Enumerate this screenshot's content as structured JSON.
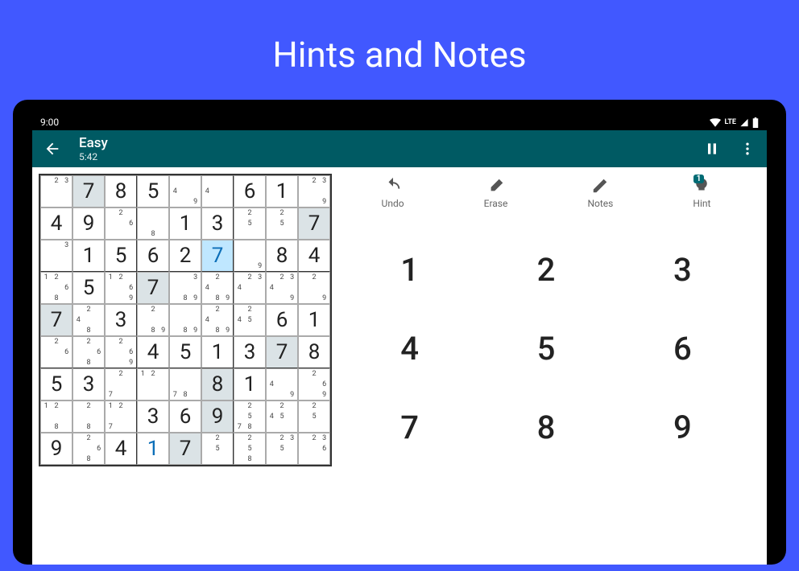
{
  "promo_title": "Hints and Notes",
  "status": {
    "time": "9:00",
    "lte": "LTE"
  },
  "appbar": {
    "title": "Easy",
    "timer": "5:42"
  },
  "actions": {
    "undo": "Undo",
    "erase": "Erase",
    "notes": "Notes",
    "hint": "Hint",
    "hint_badge": "1"
  },
  "numpad": [
    "1",
    "2",
    "3",
    "4",
    "5",
    "6",
    "7",
    "8",
    "9"
  ],
  "board": [
    [
      {
        "n": [
          null,
          "2",
          "3",
          null,
          null,
          null,
          null,
          null,
          null
        ]
      },
      {
        "v": "7",
        "f": 1
      },
      {
        "v": "8"
      },
      {
        "v": "5"
      },
      {
        "n": [
          null,
          null,
          null,
          "4",
          null,
          null,
          null,
          null,
          "9"
        ]
      },
      {
        "n": [
          null,
          null,
          null,
          "4",
          null,
          null,
          null,
          null,
          null
        ]
      },
      {
        "v": "6"
      },
      {
        "v": "1"
      },
      {
        "n": [
          null,
          "2",
          "3",
          null,
          null,
          null,
          null,
          null,
          "9"
        ]
      }
    ],
    [
      {
        "v": "4"
      },
      {
        "v": "9"
      },
      {
        "n": [
          null,
          "2",
          null,
          null,
          null,
          "6",
          null,
          null,
          null
        ]
      },
      {
        "n": [
          null,
          null,
          null,
          null,
          null,
          null,
          null,
          "8",
          null
        ]
      },
      {
        "v": "1"
      },
      {
        "v": "3"
      },
      {
        "n": [
          null,
          "2",
          null,
          null,
          "5",
          null,
          null,
          null,
          null
        ]
      },
      {
        "n": [
          null,
          "2",
          null,
          null,
          "5",
          null,
          null,
          null,
          null
        ]
      },
      {
        "v": "7",
        "f": 1
      }
    ],
    [
      {
        "n": [
          null,
          null,
          "3",
          null,
          null,
          null,
          null,
          null,
          null
        ]
      },
      {
        "v": "1"
      },
      {
        "v": "5"
      },
      {
        "v": "6"
      },
      {
        "v": "2"
      },
      {
        "v": "7",
        "u": 1,
        "hi": 1
      },
      {
        "n": [
          null,
          null,
          null,
          null,
          null,
          null,
          null,
          null,
          "9"
        ]
      },
      {
        "v": "8"
      },
      {
        "v": "4"
      }
    ],
    [
      {
        "n": [
          "1",
          "2",
          null,
          null,
          null,
          "6",
          null,
          "8",
          null
        ]
      },
      {
        "v": "5"
      },
      {
        "n": [
          "1",
          "2",
          null,
          null,
          null,
          "6",
          null,
          null,
          "9"
        ]
      },
      {
        "v": "7",
        "f": 1
      },
      {
        "n": [
          null,
          null,
          "3",
          null,
          null,
          null,
          null,
          "8",
          "9"
        ]
      },
      {
        "n": [
          null,
          "2",
          null,
          "4",
          null,
          null,
          null,
          "8",
          "9"
        ]
      },
      {
        "n": [
          null,
          "2",
          "3",
          "4",
          null,
          null,
          null,
          null,
          null
        ]
      },
      {
        "n": [
          null,
          "2",
          "3",
          "4",
          null,
          null,
          null,
          null,
          "9"
        ]
      },
      {
        "n": [
          null,
          "2",
          null,
          null,
          null,
          null,
          null,
          null,
          "9"
        ]
      }
    ],
    [
      {
        "v": "7",
        "f": 1
      },
      {
        "n": [
          null,
          "2",
          null,
          "4",
          null,
          null,
          null,
          "8",
          null
        ]
      },
      {
        "v": "3"
      },
      {
        "n": [
          null,
          "2",
          null,
          null,
          null,
          null,
          null,
          "8",
          "9"
        ]
      },
      {
        "n": [
          null,
          null,
          null,
          null,
          null,
          null,
          null,
          "8",
          "9"
        ]
      },
      {
        "n": [
          null,
          "2",
          null,
          "4",
          null,
          null,
          null,
          "8",
          "9"
        ]
      },
      {
        "n": [
          null,
          "2",
          null,
          "4",
          "5",
          null,
          null,
          null,
          null
        ]
      },
      {
        "v": "6"
      },
      {
        "v": "1"
      }
    ],
    [
      {
        "n": [
          null,
          "2",
          null,
          null,
          null,
          "6",
          null,
          null,
          null
        ]
      },
      {
        "n": [
          null,
          "2",
          null,
          null,
          null,
          "6",
          null,
          "8",
          null
        ]
      },
      {
        "n": [
          null,
          "2",
          null,
          null,
          null,
          "6",
          null,
          null,
          "9"
        ]
      },
      {
        "v": "4"
      },
      {
        "v": "5"
      },
      {
        "v": "1"
      },
      {
        "v": "3"
      },
      {
        "v": "7",
        "f": 1
      },
      {
        "v": "8"
      }
    ],
    [
      {
        "v": "5"
      },
      {
        "v": "3"
      },
      {
        "n": [
          null,
          "2",
          null,
          null,
          null,
          null,
          "7",
          null,
          null
        ]
      },
      {
        "n": [
          "1",
          "2",
          null,
          null,
          null,
          null,
          null,
          null,
          null
        ]
      },
      {
        "n": [
          null,
          null,
          null,
          null,
          null,
          null,
          "7",
          "8",
          null
        ]
      },
      {
        "v": "8",
        "f": 1
      },
      {
        "v": "1"
      },
      {
        "n": [
          null,
          null,
          null,
          "4",
          null,
          null,
          null,
          null,
          "9"
        ]
      },
      {
        "n": [
          null,
          "2",
          null,
          null,
          null,
          "6",
          null,
          null,
          "9"
        ]
      }
    ],
    [
      {
        "n": [
          "1",
          "2",
          null,
          null,
          null,
          null,
          null,
          "8",
          null
        ]
      },
      {
        "n": [
          null,
          "2",
          null,
          null,
          null,
          null,
          null,
          "8",
          null
        ]
      },
      {
        "n": [
          "1",
          "2",
          null,
          null,
          null,
          null,
          "7",
          null,
          null
        ]
      },
      {
        "v": "3"
      },
      {
        "v": "6"
      },
      {
        "v": "9",
        "f": 1
      },
      {
        "n": [
          null,
          "2",
          null,
          null,
          "5",
          null,
          "7",
          "8",
          null
        ]
      },
      {
        "n": [
          null,
          "2",
          null,
          "4",
          "5",
          null,
          null,
          null,
          null
        ]
      },
      {
        "n": [
          null,
          "2",
          null,
          null,
          "5",
          null,
          null,
          null,
          null
        ]
      }
    ],
    [
      {
        "v": "9"
      },
      {
        "n": [
          null,
          "2",
          null,
          null,
          null,
          "6",
          null,
          "8",
          null
        ]
      },
      {
        "v": "4"
      },
      {
        "v": "1",
        "u": 1
      },
      {
        "v": "7",
        "f": 1
      },
      {
        "n": [
          null,
          "2",
          null,
          null,
          "5",
          null,
          null,
          null,
          null
        ]
      },
      {
        "n": [
          null,
          "2",
          null,
          null,
          "5",
          null,
          null,
          "8",
          null
        ]
      },
      {
        "n": [
          null,
          "2",
          "3",
          null,
          "5",
          null,
          null,
          null,
          null
        ]
      },
      {
        "n": [
          null,
          "2",
          "3",
          null,
          null,
          "6",
          null,
          null,
          null
        ]
      }
    ]
  ]
}
